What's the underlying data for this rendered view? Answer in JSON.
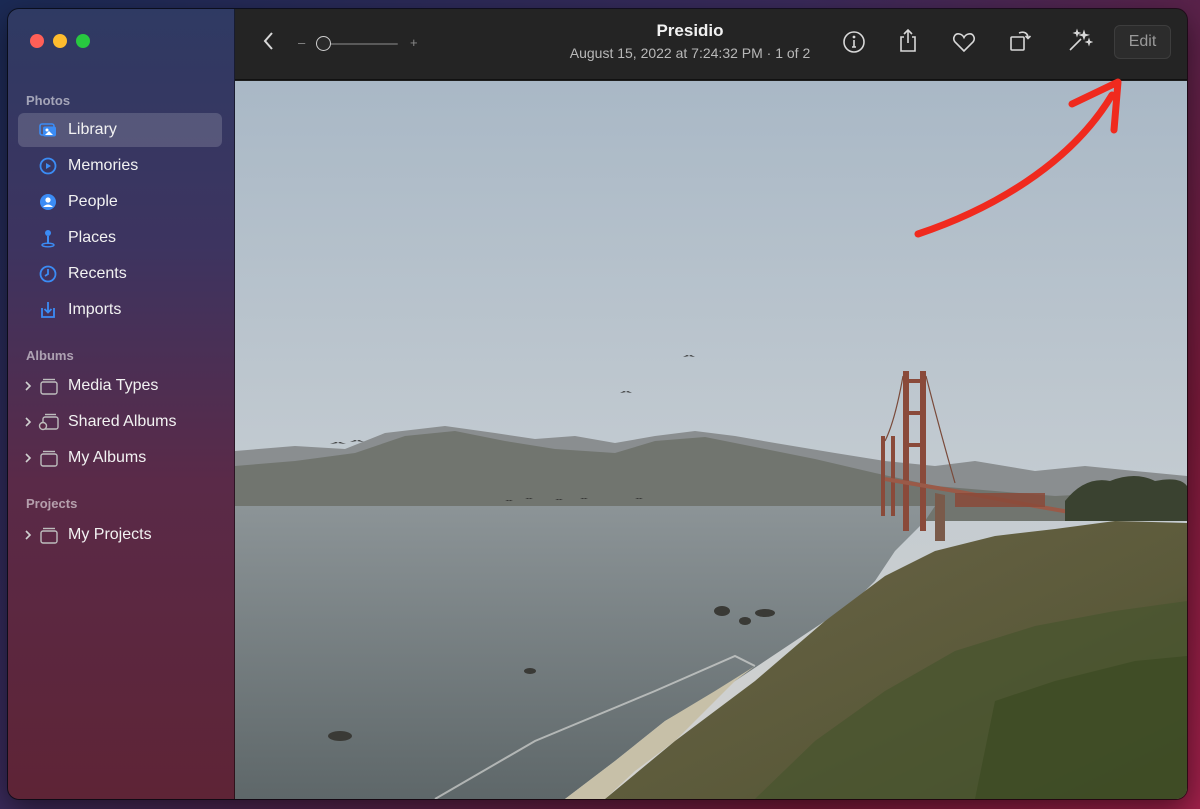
{
  "sidebar": {
    "sections": {
      "photos": "Photos",
      "albums": "Albums",
      "projects": "Projects"
    },
    "photo_items": [
      {
        "label": "Library",
        "icon": "library-icon",
        "selected": true
      },
      {
        "label": "Memories",
        "icon": "memories-icon",
        "selected": false
      },
      {
        "label": "People",
        "icon": "people-icon",
        "selected": false
      },
      {
        "label": "Places",
        "icon": "places-icon",
        "selected": false
      },
      {
        "label": "Recents",
        "icon": "recents-icon",
        "selected": false
      },
      {
        "label": "Imports",
        "icon": "imports-icon",
        "selected": false
      }
    ],
    "album_items": [
      {
        "label": "Media Types",
        "icon": "folder-stack-icon"
      },
      {
        "label": "Shared Albums",
        "icon": "shared-albums-icon"
      },
      {
        "label": "My Albums",
        "icon": "folder-stack-icon"
      }
    ],
    "project_items": [
      {
        "label": "My Projects",
        "icon": "folder-stack-icon"
      }
    ]
  },
  "toolbar": {
    "title": "Presidio",
    "subtitle": "August 15, 2022 at 7:24:32 PM  ·  1 of 2",
    "zoom_minus": "–",
    "zoom_plus": "+",
    "zoom_level": 0.05,
    "edit_label": "Edit"
  },
  "colors": {
    "accent": "#3b8cf5",
    "annotation_arrow": "#f02a1e"
  }
}
